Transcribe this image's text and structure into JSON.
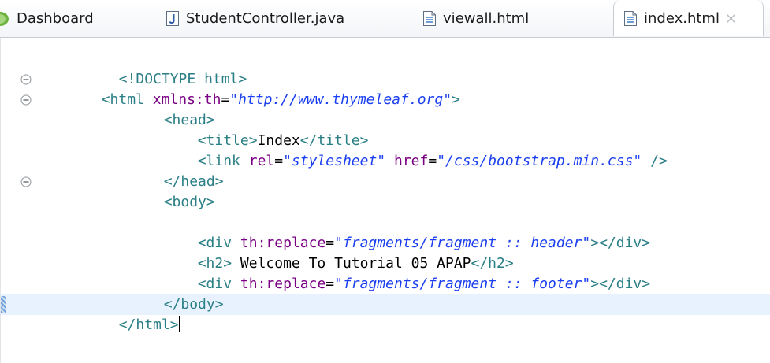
{
  "tabs": [
    {
      "label": "Dashboard",
      "icon": "spring-dashboard-icon",
      "active": false
    },
    {
      "label": "StudentController.java",
      "icon": "java-file-icon",
      "active": false
    },
    {
      "label": "viewall.html",
      "icon": "html-file-icon",
      "active": false
    },
    {
      "label": "index.html",
      "icon": "html-file-icon",
      "active": true,
      "close_glyph": "✕"
    }
  ],
  "colors": {
    "tag": "#2a7f86",
    "attribute": "#7a0083",
    "string": "#1b3ff0",
    "text": "#000000",
    "current_line": "#e8f2fe"
  },
  "code": {
    "line1": {
      "doctype": "<!DOCTYPE html>"
    },
    "line2": {
      "open": "<html",
      "attr": "xmlns:th",
      "eq": "=",
      "value": "\"http://www.thymeleaf.org\"",
      "close": ">"
    },
    "line3": {
      "tag": "<head>"
    },
    "line4": {
      "open": "<title>",
      "text": "Index",
      "close": "</title>"
    },
    "line5": {
      "open": "<link",
      "attr1": "rel",
      "eq1": "=",
      "value1": "\"stylesheet\"",
      "attr2": "href",
      "eq2": "=",
      "value2": "\"/css/bootstrap.min.css\"",
      "close": " />"
    },
    "line6": {
      "tag": "</head>"
    },
    "line7": {
      "tag": "<body>"
    },
    "line9": {
      "open": "<div",
      "attr": "th:replace",
      "eq": "=",
      "value": "\"fragments/fragment :: header\"",
      "close": "></div>"
    },
    "line10": {
      "open": "<h2>",
      "text": " Welcome To Tutorial 05 APAP",
      "close": "</h2>"
    },
    "line11": {
      "open": "<div",
      "attr": "th:replace",
      "eq": "=",
      "value": "\"fragments/fragment :: footer\"",
      "close": "></div>"
    },
    "line12": {
      "tag": "</body>"
    },
    "line13": {
      "tag": "</html>"
    }
  }
}
